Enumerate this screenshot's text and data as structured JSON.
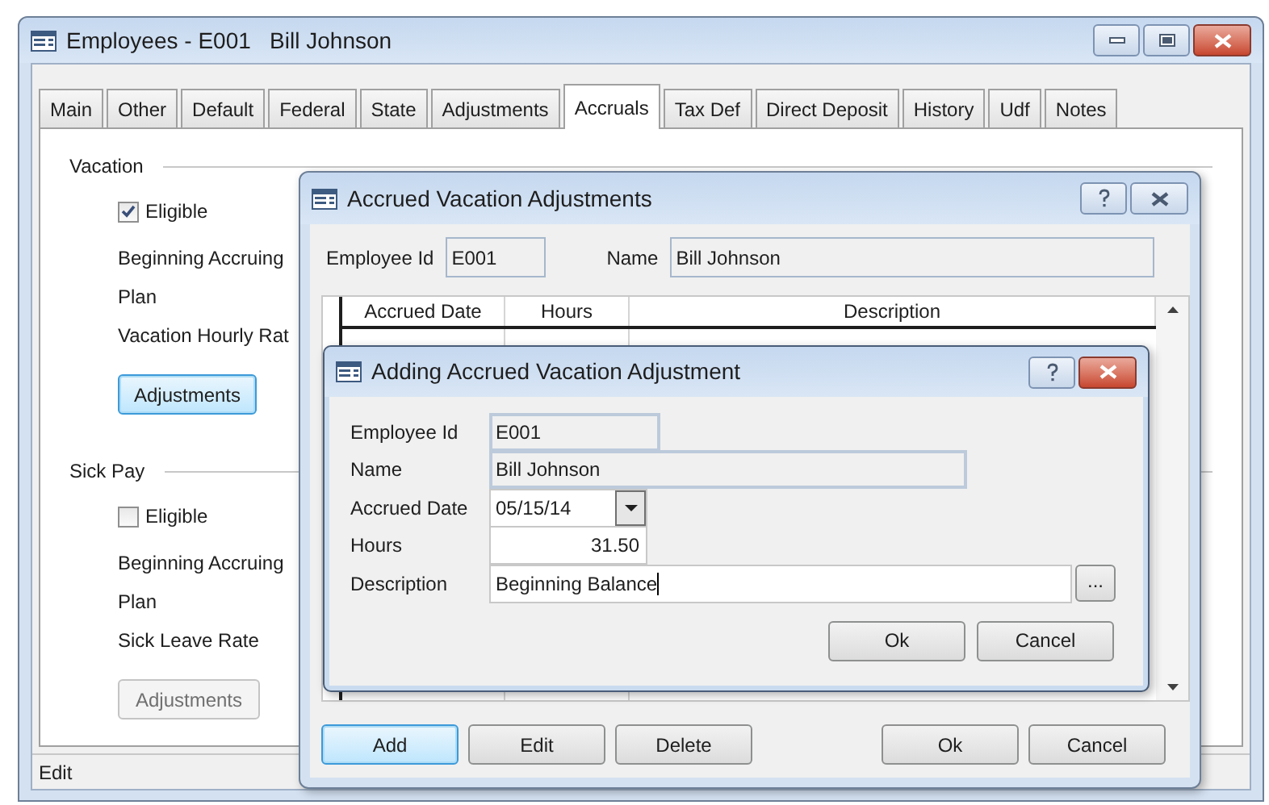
{
  "window": {
    "title": "Employees - E001   Bill Johnson"
  },
  "tabs": [
    {
      "label": "Main",
      "selected": false
    },
    {
      "label": "Other",
      "selected": false
    },
    {
      "label": "Default",
      "selected": false
    },
    {
      "label": "Federal",
      "selected": false
    },
    {
      "label": "State",
      "selected": false
    },
    {
      "label": "Adjustments",
      "selected": false
    },
    {
      "label": "Accruals",
      "selected": true
    },
    {
      "label": "Tax Def",
      "selected": false
    },
    {
      "label": "Direct Deposit",
      "selected": false
    },
    {
      "label": "History",
      "selected": false
    },
    {
      "label": "Udf",
      "selected": false
    },
    {
      "label": "Notes",
      "selected": false
    }
  ],
  "sections": [
    {
      "title": "Vacation",
      "eligible": {
        "label": "Eligible",
        "checked": true
      },
      "fields": [
        "Beginning Accruing",
        "Plan",
        "Vacation Hourly Rat"
      ],
      "button": {
        "label": "Adjustments",
        "disabled": false,
        "default": true
      }
    },
    {
      "title": "Sick Pay",
      "eligible": {
        "label": "Eligible",
        "checked": false
      },
      "fields": [
        "Beginning Accruing",
        "Plan",
        "Sick Leave Rate"
      ],
      "button": {
        "label": "Adjustments",
        "disabled": true,
        "default": false
      }
    }
  ],
  "status_bar": "Edit",
  "adjustments_dialog": {
    "title": "Accrued Vacation Adjustments",
    "employee_id_label": "Employee Id",
    "employee_id": "E001",
    "name_label": "Name",
    "name": "Bill Johnson",
    "table": {
      "columns": [
        "Accrued Date",
        "Hours",
        "Description"
      ]
    },
    "buttons": [
      {
        "label": "Add",
        "default": true
      },
      {
        "label": "Edit",
        "default": false
      },
      {
        "label": "Delete",
        "default": false
      },
      {
        "label": "Ok",
        "default": false
      },
      {
        "label": "Cancel",
        "default": false
      }
    ]
  },
  "add_dialog": {
    "title": "Adding Accrued Vacation Adjustment",
    "fields": [
      {
        "label": "Employee Id",
        "value": "E001",
        "kind": "readonly"
      },
      {
        "label": "Name",
        "value": "Bill Johnson",
        "kind": "readonly"
      },
      {
        "label": "Accrued Date",
        "value": "05/15/14",
        "kind": "date"
      },
      {
        "label": "Hours",
        "value": "31.50",
        "kind": "number"
      },
      {
        "label": "Description",
        "value": "Beginning Balance",
        "kind": "text",
        "browse": "..."
      }
    ],
    "buttons": [
      {
        "label": "Ok",
        "default": false
      },
      {
        "label": "Cancel",
        "default": false
      }
    ]
  }
}
